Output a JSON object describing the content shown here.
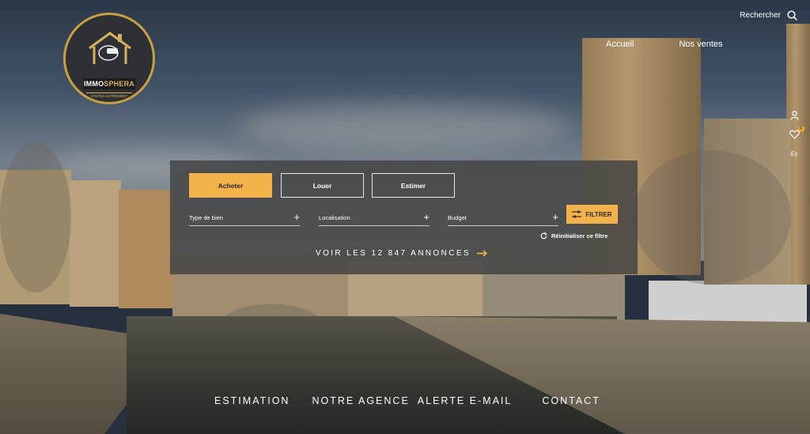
{
  "logo": {
    "brand_a": "IMMO",
    "brand_b": "SPHERA",
    "tagline": "VISITEZ AUTREMENT"
  },
  "header": {
    "search_label": "Rechercher"
  },
  "nav": [
    {
      "label": "Accueil"
    },
    {
      "label": "Nos ventes"
    }
  ],
  "side": {
    "favorites_count": "0",
    "language": "Fr"
  },
  "search_panel": {
    "tabs": [
      {
        "label": "Acheter"
      },
      {
        "label": "Louer"
      },
      {
        "label": "Estimer"
      }
    ],
    "fields": [
      {
        "label": "Type de bien"
      },
      {
        "label": "Localisation"
      },
      {
        "label": "Budget"
      }
    ],
    "filter_label": "FILTRER",
    "reset_label": "Réinitialiser ce filtre",
    "see_all_label": "VOIR LES 12 847 ANNONCES"
  },
  "footer_nav": [
    {
      "label": "ESTIMATION"
    },
    {
      "label": "NOTRE AGENCE"
    },
    {
      "label": "ALERTE E-MAIL"
    },
    {
      "label": "CONTACT"
    }
  ],
  "colors": {
    "accent": "#f4b24a",
    "panel": "#444444",
    "logo_gold": "#c9a040"
  }
}
